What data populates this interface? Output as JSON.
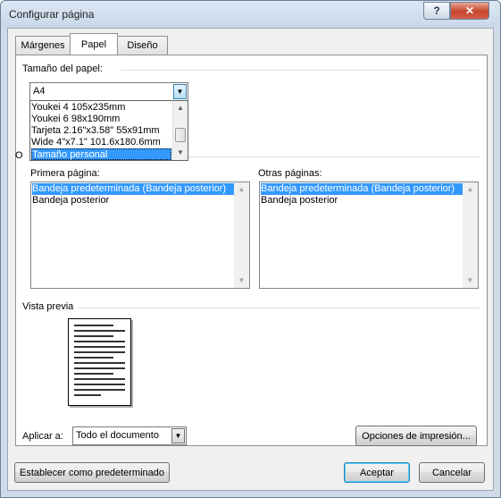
{
  "window": {
    "title": "Configurar página",
    "help_glyph": "?",
    "close_glyph": "✕"
  },
  "tabs": [
    {
      "label": "Márgenes",
      "active": false
    },
    {
      "label": "Papel",
      "active": true
    },
    {
      "label": "Diseño",
      "active": false
    }
  ],
  "paper_size": {
    "group_label": "Tamaño del papel:",
    "selected_value": "A4",
    "dropdown_items": [
      "Youkei 4 105x235mm",
      "Youkei 6 98x190mm",
      "Tarjeta 2.16\"x3.58\" 55x91mm",
      "Wide 4\"x7.1\" 101.6x180.6mm",
      "Tamaño personal"
    ],
    "highlighted_index": 4
  },
  "paper_source": {
    "group_label_partial": "O",
    "first_page_label": "Primera página:",
    "other_pages_label": "Otras páginas:",
    "first_page_items": [
      "Bandeja predeterminada (Bandeja posterior)",
      "Bandeja posterior"
    ],
    "other_pages_items": [
      "Bandeja predeterminada (Bandeja posterior)",
      "Bandeja posterior"
    ],
    "selected_index": 0
  },
  "preview": {
    "label": "Vista previa"
  },
  "apply_to": {
    "label": "Aplicar a:",
    "value": "Todo el documento"
  },
  "buttons": {
    "print_options": "Opciones de impresión...",
    "set_default": "Establecer como predeterminado",
    "ok": "Aceptar",
    "cancel": "Cancelar"
  },
  "colors": {
    "selection": "#3399ff",
    "close_button": "#c7432b"
  }
}
